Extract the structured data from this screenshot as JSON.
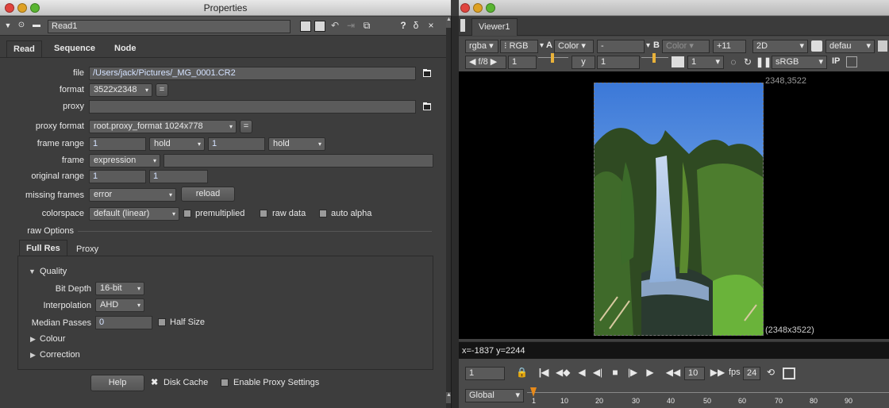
{
  "properties_window": {
    "title": "Properties"
  },
  "node": {
    "name": "Read1",
    "help_glyph": "?",
    "pin_glyph": "δ",
    "close_glyph": "×"
  },
  "node_tabs": [
    "Read",
    "Sequence",
    "Node"
  ],
  "read": {
    "file_label": "file",
    "file_value": "/Users/jack/Pictures/_MG_0001.CR2",
    "format_label": "format",
    "format_value": "3522x2348",
    "proxy_label": "proxy",
    "proxy_value": "",
    "proxy_format_label": "proxy format",
    "proxy_format_value": "root.proxy_format 1024x778",
    "frame_range_label": "frame range",
    "frame_range_start": "1",
    "frame_range_before": "hold",
    "frame_range_end": "1",
    "frame_range_after": "hold",
    "frame_label": "frame",
    "frame_mode": "expression",
    "frame_value": "",
    "original_range_label": "original range",
    "original_range_start": "1",
    "original_range_end": "1",
    "missing_frames_label": "missing frames",
    "missing_frames_value": "error",
    "reload_label": "reload",
    "colorspace_label": "colorspace",
    "colorspace_value": "default (linear)",
    "premultiplied_label": "premultiplied",
    "raw_data_label": "raw data",
    "auto_alpha_label": "auto alpha",
    "raw_options_label": "raw Options"
  },
  "raw_tabs": [
    "Full Res",
    "Proxy"
  ],
  "quality": {
    "group_label": "Quality",
    "bit_depth_label": "Bit Depth",
    "bit_depth_value": "16-bit",
    "interpolation_label": "Interpolation",
    "interpolation_value": "AHD",
    "median_passes_label": "Median Passes",
    "median_passes_value": "0",
    "half_size_label": "Half Size",
    "colour_label": "Colour",
    "correction_label": "Correction"
  },
  "footer": {
    "help_label": "Help",
    "disk_cache_label": "Disk Cache",
    "enable_proxy_label": "Enable Proxy Settings"
  },
  "viewer": {
    "tab_label": "Viewer1",
    "channels": "rgba",
    "rgb": "RGB",
    "a_label": "A",
    "a_value": "Color",
    "a_op": "-",
    "b_label": "B",
    "b_value": "Color",
    "gain_value": "+11",
    "mode_2d": "2D",
    "lut": "defau",
    "fstop": "f/8",
    "fstop_value": "1",
    "y_label": "y",
    "y_value": "1",
    "frame_value": "1",
    "colorspace": "sRGB",
    "ip_label": "IP",
    "corner_top_right": "2348,3522",
    "corner_bottom_right": "(2348x3522)",
    "coords": "x=-1837 y=2244",
    "timeline_frame": "1",
    "increment": "10",
    "fps_label": "fps",
    "fps_value": "24",
    "global_label": "Global",
    "ruler_ticks": [
      "1",
      "10",
      "20",
      "30",
      "40",
      "50",
      "60",
      "70",
      "80",
      "90"
    ]
  },
  "colors": {
    "accent_blue": "#d4e2ff",
    "panel": "#3d3d3d",
    "viewer_bg": "#000000"
  }
}
